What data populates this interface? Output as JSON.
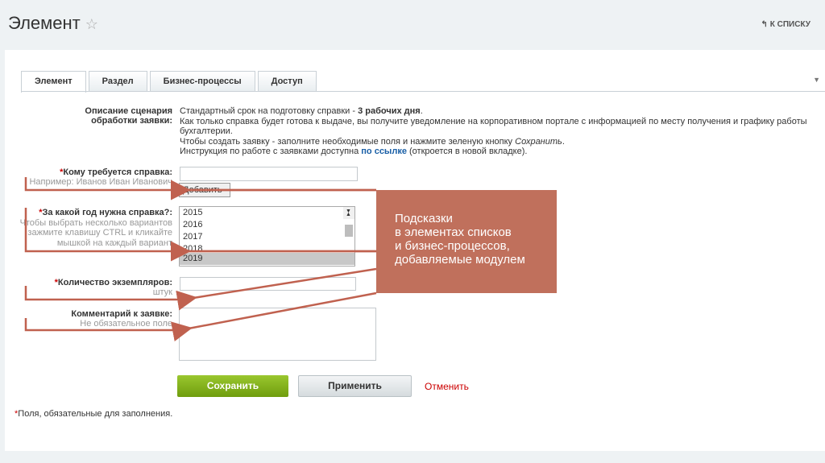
{
  "header": {
    "title": "Элемент",
    "back_label": "К СПИСКУ"
  },
  "tabs": [
    {
      "label": "Элемент",
      "active": true
    },
    {
      "label": "Раздел"
    },
    {
      "label": "Бизнес-процессы"
    },
    {
      "label": "Доступ"
    }
  ],
  "form": {
    "description": {
      "label": "Описание сценария обработки заявки:",
      "line1": "Стандартный срок на подготовку справки - ",
      "line1_bold": "3 рабочих дня",
      "line2": "Как только справка будет готова к выдаче, вы получите уведомление на корпоративном портале с информацией по месту получения и графику работы бухгалтерии.",
      "line3": "Чтобы создать заявку - заполните необходимые поля и нажмите зеленую кнопку ",
      "line3_italic": "Сохранить",
      "line4": "Инструкция по работе с заявками доступна ",
      "link": "по ссылке",
      "line4_end": " (откроется в новой вкладке)."
    },
    "recipient": {
      "label": "Кому требуется справка:",
      "hint": "Например: Иванов Иван Иванович",
      "value": "",
      "add_button": "Добавить"
    },
    "year": {
      "label": "За какой год нужна справка?:",
      "hint": "Чтобы выбрать несколько вариантов зажмите клавишу CTRL и кликайте мышкой на каждый вариант",
      "options": [
        "2015",
        "2016",
        "2017",
        "2018",
        "2019"
      ],
      "selected": "2019"
    },
    "copies": {
      "label": "Количество экземпляров:",
      "hint": "штук",
      "value": ""
    },
    "comment": {
      "label": "Комментарий к заявке:",
      "hint": "Не обязательное поле",
      "value": ""
    }
  },
  "buttons": {
    "save": "Сохранить",
    "apply": "Применить",
    "cancel": "Отменить"
  },
  "footnote": "Поля, обязательные для заполнения.",
  "callout": {
    "text": [
      "Подсказки",
      "в элементах списков",
      "и бизнес-процессов,",
      "добавляемые модулем"
    ]
  },
  "colors": {
    "accent_arrow": "#c0614f",
    "callout_bg": "#c0705c",
    "save_green": "#86b41f"
  }
}
